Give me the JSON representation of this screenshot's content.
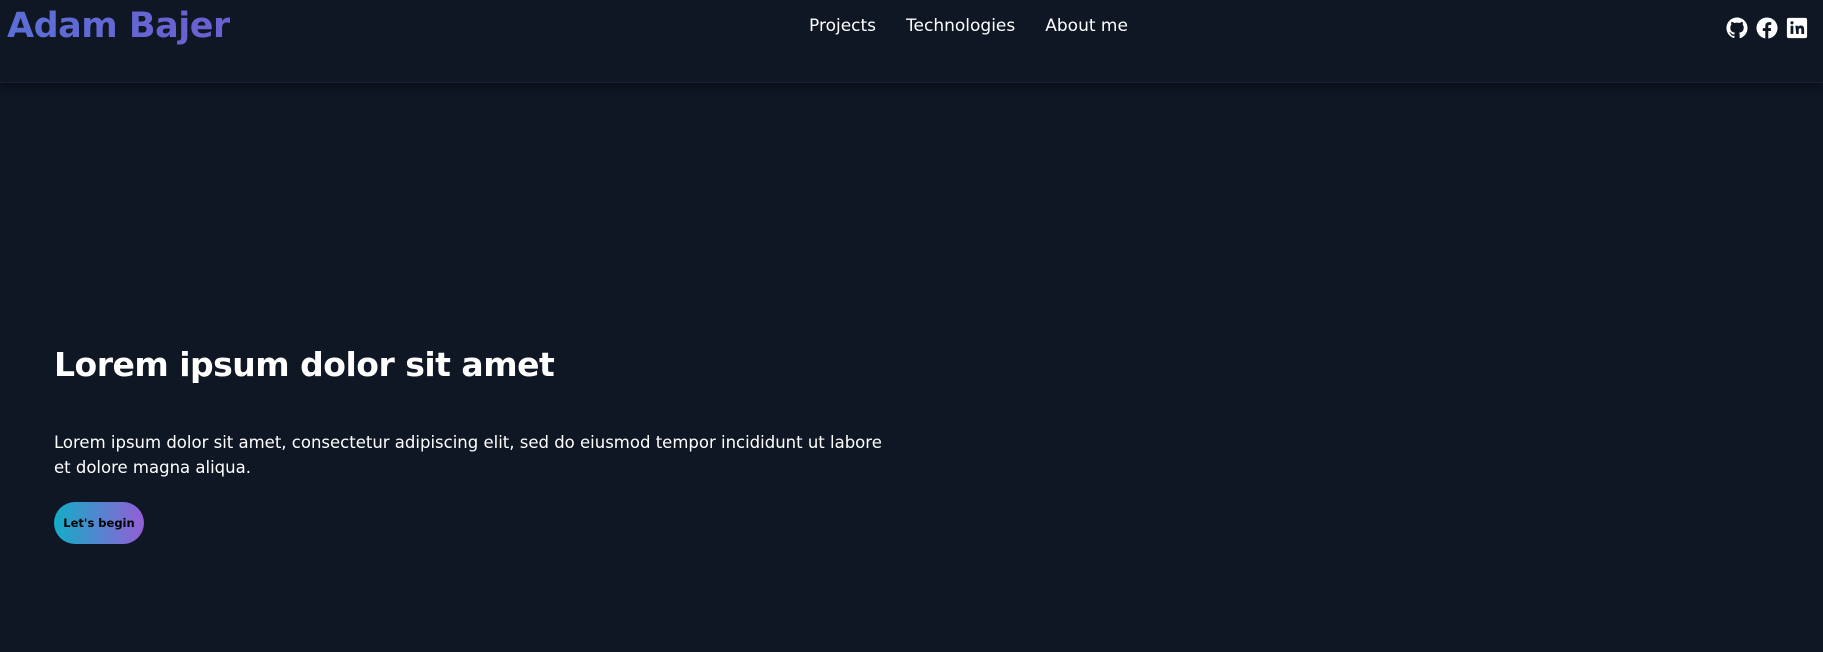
{
  "header": {
    "logo": "Adam Bajer",
    "nav": [
      {
        "label": "Projects"
      },
      {
        "label": "Technologies"
      },
      {
        "label": "About me"
      }
    ],
    "social": [
      {
        "icon": "github-icon"
      },
      {
        "icon": "facebook-icon"
      },
      {
        "icon": "linkedin-icon"
      }
    ]
  },
  "hero": {
    "title": "Lorem ipsum dolor sit amet",
    "text": "Lorem ipsum dolor sit amet, consectetur adipiscing elit, sed do eiusmod tempor incididunt ut labore et dolore magna aliqua.",
    "button_label": "Let's begin"
  },
  "colors": {
    "background": "#0f1624",
    "logo_gradient_start": "#5b6fd6",
    "logo_gradient_end": "#6c5fd0",
    "button_gradient_start": "#13adc7",
    "button_gradient_end": "#945dd6",
    "text": "#ffffff"
  }
}
